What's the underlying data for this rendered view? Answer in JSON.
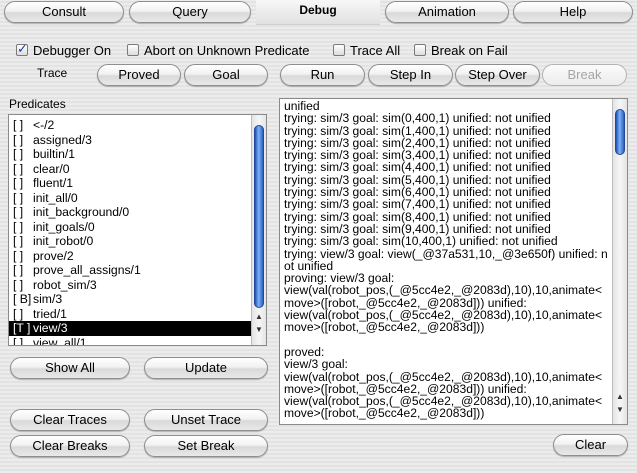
{
  "tabs": [
    {
      "label": "Consult",
      "active": false
    },
    {
      "label": "Query",
      "active": false
    },
    {
      "label": "Debug",
      "active": true
    },
    {
      "label": "Animation",
      "active": false
    },
    {
      "label": "Help",
      "active": false
    }
  ],
  "options": {
    "debugger_on": {
      "label": "Debugger On",
      "checked": true
    },
    "abort_unknown": {
      "label": "Abort on Unknown Predicate",
      "checked": false
    },
    "trace_all": {
      "label": "Trace All",
      "checked": false
    },
    "break_on_fail": {
      "label": "Break on Fail",
      "checked": false
    }
  },
  "trace_label": "Trace",
  "trace_buttons": {
    "proved": "Proved",
    "goal": "Goal"
  },
  "run_buttons": {
    "run": "Run",
    "step_in": "Step In",
    "step_over": "Step Over",
    "break": "Break"
  },
  "predicates": {
    "label": "Predicates",
    "items": [
      {
        "flag": "[  ]",
        "name": "<-/2"
      },
      {
        "flag": "[  ]",
        "name": "assigned/3"
      },
      {
        "flag": "[  ]",
        "name": "builtin/1"
      },
      {
        "flag": "[  ]",
        "name": "clear/0"
      },
      {
        "flag": "[  ]",
        "name": "fluent/1"
      },
      {
        "flag": "[  ]",
        "name": "init_all/0"
      },
      {
        "flag": "[  ]",
        "name": "init_background/0"
      },
      {
        "flag": "[  ]",
        "name": "init_goals/0"
      },
      {
        "flag": "[  ]",
        "name": "init_robot/0"
      },
      {
        "flag": "[  ]",
        "name": "prove/2"
      },
      {
        "flag": "[  ]",
        "name": "prove_all_assigns/1"
      },
      {
        "flag": "[  ]",
        "name": "robot_sim/3"
      },
      {
        "flag": "[ B]",
        "name": "sim/3"
      },
      {
        "flag": "[  ]",
        "name": "tried/1"
      },
      {
        "flag": "[T ]",
        "name": "view/3",
        "selected": true
      },
      {
        "flag": "[  ]",
        "name": "view_all/1"
      }
    ]
  },
  "list_buttons": {
    "show_all": "Show All",
    "update": "Update"
  },
  "bottom_buttons": {
    "clear_traces": "Clear Traces",
    "unset_trace": "Unset Trace",
    "clear_breaks": "Clear Breaks",
    "set_break": "Set Break",
    "clear": "Clear"
  },
  "trace_output": "unified\ntrying: sim/3 goal: sim(0,400,1) unified: not unified\ntrying: sim/3 goal: sim(1,400,1) unified: not unified\ntrying: sim/3 goal: sim(2,400,1) unified: not unified\ntrying: sim/3 goal: sim(3,400,1) unified: not unified\ntrying: sim/3 goal: sim(4,400,1) unified: not unified\ntrying: sim/3 goal: sim(5,400,1) unified: not unified\ntrying: sim/3 goal: sim(6,400,1) unified: not unified\ntrying: sim/3 goal: sim(7,400,1) unified: not unified\ntrying: sim/3 goal: sim(8,400,1) unified: not unified\ntrying: sim/3 goal: sim(9,400,1) unified: not unified\ntrying: sim/3 goal: sim(10,400,1) unified: not unified\ntrying: view/3 goal: view(_@37a531,10,_@3e650f) unified: not unified\nproving: view/3 goal:\nview(val(robot_pos,(_@5cc4e2,_@2083d),10),10,animate<move>([robot,_@5cc4e2,_@2083d])) unified:\nview(val(robot_pos,(_@5cc4e2,_@2083d),10),10,animate<move>([robot,_@5cc4e2,_@2083d]))\n\nproved:\nview/3 goal:\nview(val(robot_pos,(_@5cc4e2,_@2083d),10),10,animate<move>([robot,_@5cc4e2,_@2083d])) unified:\nview(val(robot_pos,(_@5cc4e2,_@2083d),10),10,animate<move>([robot,_@5cc4e2,_@2083d]))"
}
